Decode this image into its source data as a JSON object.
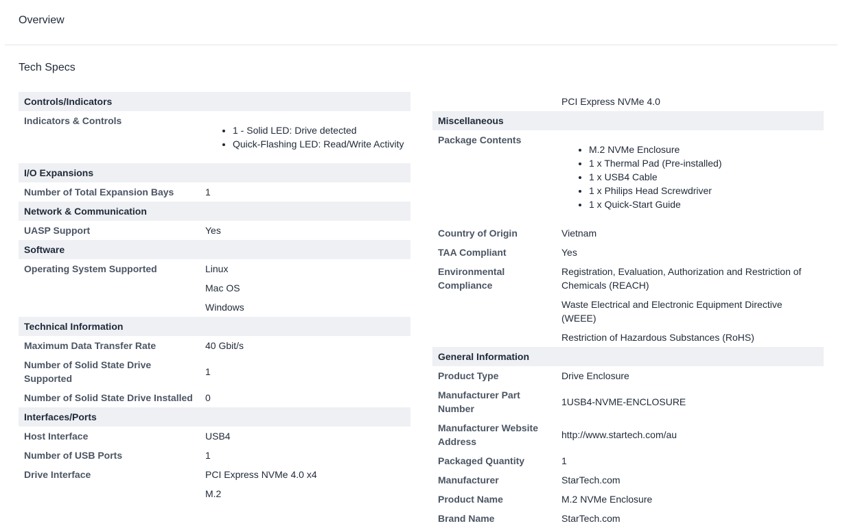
{
  "header": {
    "title": "Overview"
  },
  "section_title": "Tech Specs",
  "left": {
    "controls": {
      "header": "Controls/Indicators",
      "label": "Indicators & Controls",
      "items": [
        "1 - Solid LED: Drive detected",
        "Quick-Flashing LED: Read/Write Activity"
      ]
    },
    "io": {
      "header": "I/O Expansions",
      "bays_label": "Number of Total Expansion Bays",
      "bays_value": "1"
    },
    "network": {
      "header": "Network & Communication",
      "uasp_label": "UASP Support",
      "uasp_value": "Yes"
    },
    "software": {
      "header": "Software",
      "os_label": "Operating System Supported",
      "os_values": [
        "Linux",
        "Mac OS",
        "Windows"
      ]
    },
    "technical": {
      "header": "Technical Information",
      "rate_label": "Maximum Data Transfer Rate",
      "rate_value": "40 Gbit/s",
      "supported_label": "Number of Solid State Drive Supported",
      "supported_value": "1",
      "installed_label": "Number of Solid State Drive Installed",
      "installed_value": "0"
    },
    "interfaces": {
      "header": "Interfaces/Ports",
      "host_label": "Host Interface",
      "host_value": "USB4",
      "usb_label": "Number of USB Ports",
      "usb_value": "1",
      "drive_label": "Drive Interface",
      "drive_values": [
        "PCI Express NVMe 4.0 x4",
        "M.2"
      ]
    }
  },
  "right": {
    "continued_value": "PCI Express NVMe 4.0",
    "misc": {
      "header": "Miscellaneous",
      "package_label": "Package Contents",
      "package_items": [
        "M.2 NVMe Enclosure",
        "1 x Thermal Pad (Pre-installed)",
        "1 x USB4 Cable",
        "1 x Philips Head Screwdriver",
        "1 x Quick-Start Guide"
      ],
      "origin_label": "Country of Origin",
      "origin_value": "Vietnam",
      "taa_label": "TAA Compliant",
      "taa_value": "Yes",
      "env_label": "Environmental Compliance",
      "env_values": [
        "Registration, Evaluation, Authorization and Restriction of Chemicals (REACH)",
        "Waste Electrical and Electronic Equipment Directive (WEEE)",
        "Restriction of Hazardous Substances (RoHS)"
      ]
    },
    "general": {
      "header": "General Information",
      "type_label": "Product Type",
      "type_value": "Drive Enclosure",
      "part_label": "Manufacturer Part Number",
      "part_value": "1USB4-NVME-ENCLOSURE",
      "website_label": "Manufacturer Website Address",
      "website_value": "http://www.startech.com/au",
      "qty_label": "Packaged Quantity",
      "qty_value": "1",
      "mfr_label": "Manufacturer",
      "mfr_value": "StarTech.com",
      "name_label": "Product Name",
      "name_value": "M.2 NVMe Enclosure",
      "brand_label": "Brand Name",
      "brand_value": "StarTech.com"
    }
  }
}
